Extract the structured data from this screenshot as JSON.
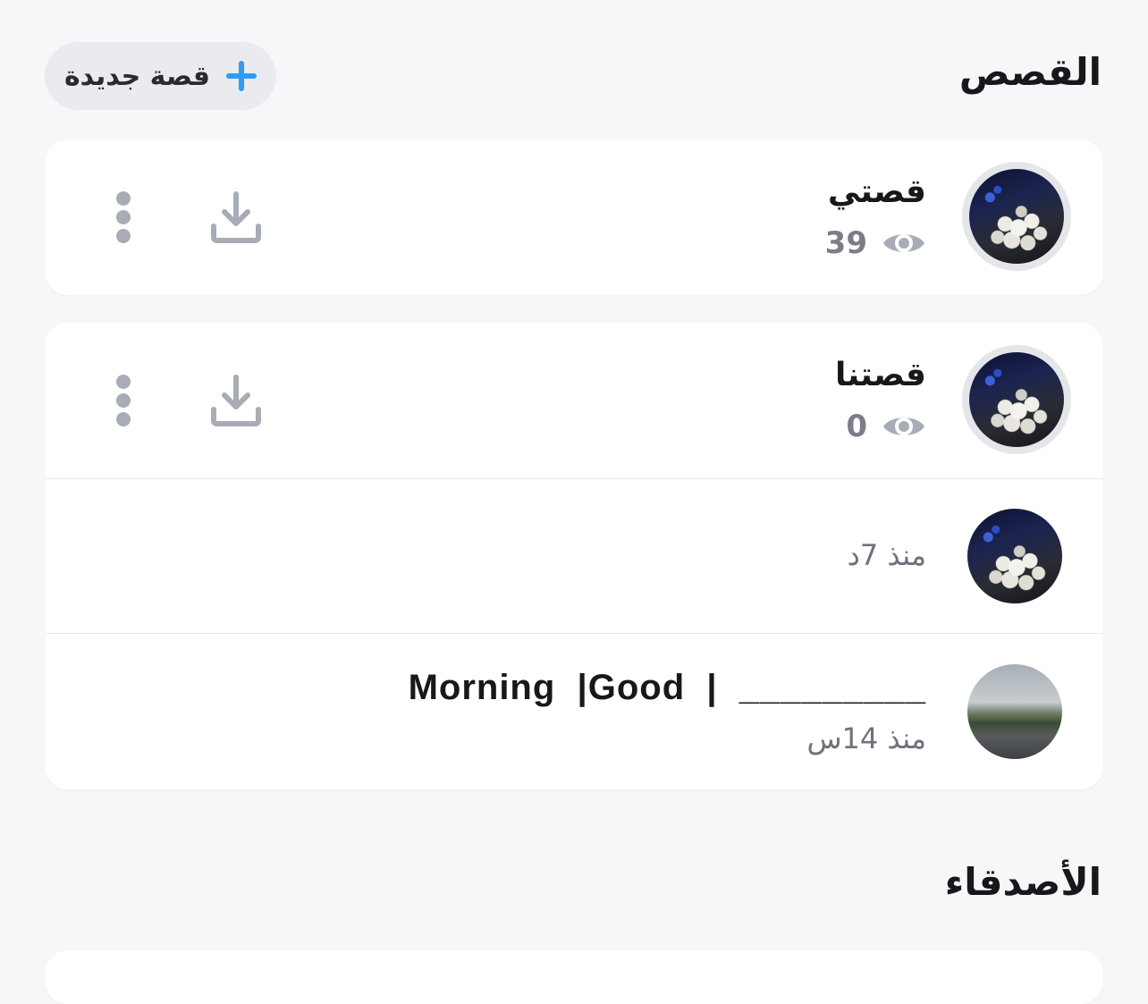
{
  "stories_section": {
    "title": "القصص",
    "new_story_label": "قصة جديدة"
  },
  "my_story": {
    "name": "قصتي",
    "views": "39"
  },
  "our_story": {
    "name": "قصتنا",
    "views": "0",
    "snaps": [
      {
        "caption": "",
        "time_ago": "منذ 7د"
      },
      {
        "caption": "Morning  |Good  |  _________",
        "time_ago": "منذ 14س"
      }
    ]
  },
  "friends_section": {
    "title": "الأصدقاء"
  },
  "icons": {
    "plus": "plus-icon",
    "eye": "eye-icon",
    "download": "download-icon",
    "more": "more-vertical-icon"
  },
  "colors": {
    "accent": "#2f9bf4",
    "background": "#f6f7f9",
    "card": "#ffffff",
    "icon_gray": "#a8acb6"
  }
}
